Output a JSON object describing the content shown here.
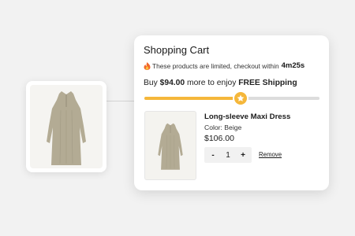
{
  "cart": {
    "title": "Shopping Cart",
    "limit_text": "These products are limited, checkout within",
    "limit_time": "4m25s",
    "shipping_prefix": "Buy",
    "shipping_amount": "$94.00",
    "shipping_middle": "more to enjoy",
    "shipping_free": "FREE Shipping",
    "progress_fraction": 0.55
  },
  "item": {
    "name": "Long-sleeve Maxi Dress",
    "color": "Color: Beige",
    "price": "$106.00",
    "quantity": "1",
    "minus_label": "-",
    "plus_label": "+",
    "remove_label": "Remove"
  },
  "colors": {
    "accent": "#f5b73a",
    "dress": "#b3ab94",
    "fire": "#f2672a"
  },
  "icons": {
    "limit": "fire-icon",
    "progress": "star-icon"
  }
}
